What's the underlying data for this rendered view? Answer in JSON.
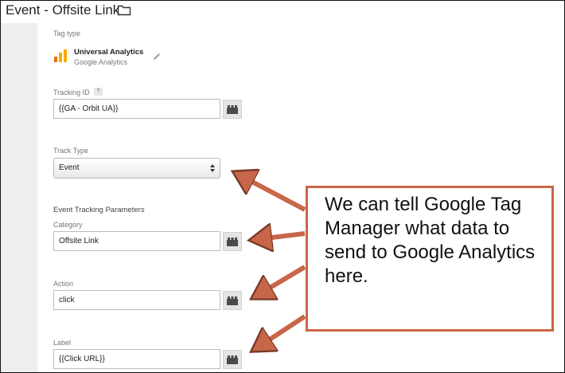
{
  "window": {
    "title": "Event - Offsite Link",
    "folder_icon": "folder-icon"
  },
  "tag_type": {
    "section_label": "Tag type",
    "name": "Universal Analytics",
    "vendor": "Google Analytics",
    "logo_icon": "google-analytics-logo",
    "edit_icon": "pencil-icon"
  },
  "tracking_id": {
    "label": "Tracking ID",
    "help": "?",
    "value": "{{GA - Orbit UA}}"
  },
  "track_type": {
    "label": "Track Type",
    "selected": "Event"
  },
  "event_params": {
    "heading": "Event Tracking Parameters",
    "category": {
      "label": "Category",
      "value": "Offsite Link"
    },
    "action": {
      "label": "Action",
      "value": "click"
    },
    "label": {
      "label": "Label",
      "value": "{{Click URL}}"
    }
  },
  "callout": {
    "text": "We can tell Google Tag Manager what data to send to Google Analytics here.",
    "border_color": "#cc6644",
    "arrow_color": "#c8664a"
  },
  "colors": {
    "accent_orange": "#f9ab00",
    "panel_bg": "#ffffff",
    "sidebar_bg": "#eeeeee"
  }
}
